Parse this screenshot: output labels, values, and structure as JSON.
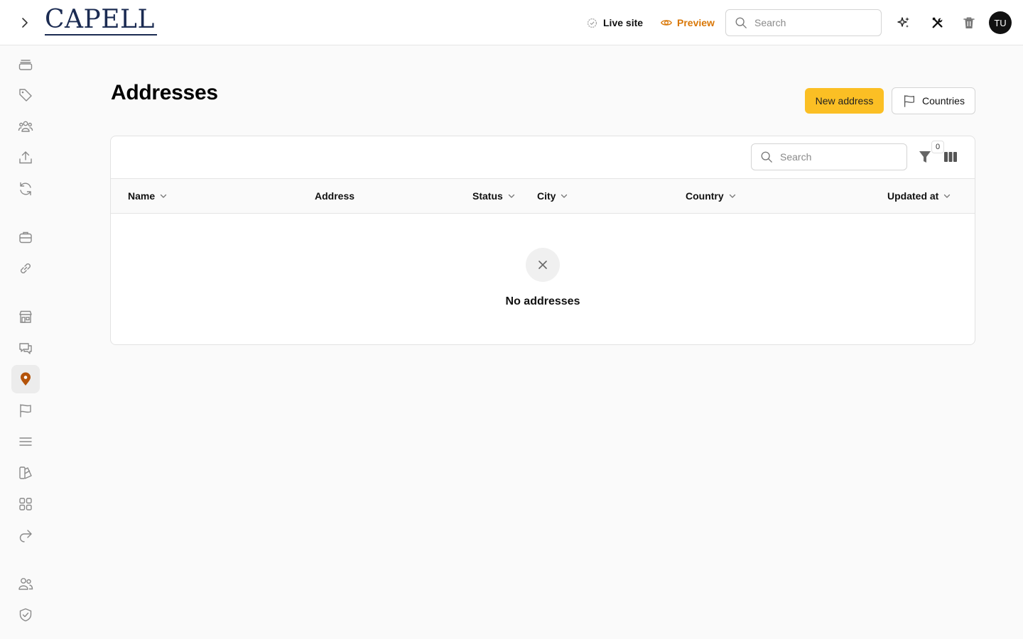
{
  "brand": {
    "name": "CAPELL"
  },
  "topbar": {
    "live_site_label": "Live site",
    "preview_label": "Preview",
    "search_placeholder": "Search",
    "avatar_initials": "TU"
  },
  "sidebar": {
    "items": [
      {
        "icon": "inbox-icon"
      },
      {
        "icon": "tag-icon"
      },
      {
        "icon": "users-group-icon"
      },
      {
        "icon": "upload-icon"
      },
      {
        "icon": "refresh-icon"
      },
      {
        "icon": "briefcase-icon"
      },
      {
        "icon": "link-icon"
      },
      {
        "icon": "store-icon"
      },
      {
        "icon": "chat-icon"
      },
      {
        "icon": "map-pin-icon",
        "active": true
      },
      {
        "icon": "flag-icon"
      },
      {
        "icon": "menu-lines-icon"
      },
      {
        "icon": "swatch-icon"
      },
      {
        "icon": "apps-grid-icon"
      },
      {
        "icon": "share-arrow-icon"
      },
      {
        "icon": "users-icon"
      },
      {
        "icon": "shield-check-icon"
      }
    ]
  },
  "page": {
    "title": "Addresses",
    "new_button_label": "New address",
    "countries_button_label": "Countries"
  },
  "table": {
    "search_placeholder": "Search",
    "filter_count": "0",
    "columns": [
      {
        "label": "Name",
        "sortable": true
      },
      {
        "label": "Address",
        "sortable": false
      },
      {
        "label": "Status",
        "sortable": true
      },
      {
        "label": "City",
        "sortable": true
      },
      {
        "label": "Country",
        "sortable": true
      },
      {
        "label": "Updated at",
        "sortable": true
      }
    ],
    "empty_message": "No addresses"
  },
  "colors": {
    "accent": "#fbbf24",
    "preview": "#d97706",
    "active_icon": "#b45309",
    "brand": "#1b2b52"
  }
}
